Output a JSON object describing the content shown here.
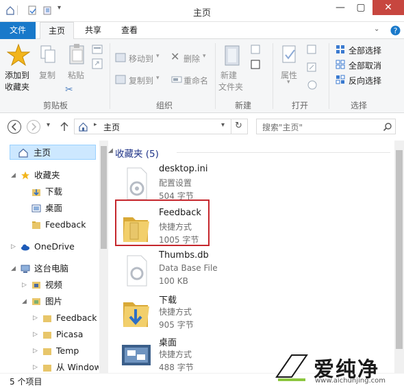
{
  "window": {
    "title": "主页",
    "controls": {
      "minimize": "—",
      "maximize": "▢",
      "close": "✕"
    }
  },
  "tabs": [
    "文件",
    "主页",
    "共享",
    "查看"
  ],
  "ribbon": {
    "pin_label_1": "添加到",
    "pin_label_2": "收藏夹",
    "copy": "复制",
    "paste": "粘贴",
    "clipboard_group": "剪贴板",
    "move_to": "移动到",
    "copy_to": "复制到",
    "delete": "删除",
    "rename": "重命名",
    "organize_group": "组织",
    "new_folder_1": "新建",
    "new_folder_2": "文件夹",
    "new_group": "新建",
    "properties": "属性",
    "open_group": "打开",
    "select_all": "全部选择",
    "select_none": "全部取消",
    "invert_selection": "反向选择",
    "select_group": "选择"
  },
  "address": {
    "path": "主页",
    "search_placeholder": "搜索\"主页\""
  },
  "nav": {
    "home": "主页",
    "favorites": "收藏夹",
    "downloads": "下载",
    "desktop": "桌面",
    "feedback": "Feedback",
    "onedrive": "OneDrive",
    "this_pc": "这台电脑",
    "videos": "视频",
    "pictures": "图片",
    "pic_feedback": "Feedback",
    "picasa": "Picasa",
    "temp": "Temp",
    "from_windows": "从 Window"
  },
  "content": {
    "group_header": "收藏夹 (5)",
    "files": [
      {
        "name": "desktop.ini",
        "type": "配置设置",
        "size": "504 字节",
        "icon": "settings-file-icon"
      },
      {
        "name": "Feedback",
        "type": "快捷方式",
        "size": "1005 字节",
        "icon": "folder-icon"
      },
      {
        "name": "Thumbs.db",
        "type": "Data Base File",
        "size": "100 KB",
        "icon": "database-file-icon"
      },
      {
        "name": "下载",
        "type": "快捷方式",
        "size": "905 字节",
        "icon": "downloads-folder-icon"
      },
      {
        "name": "桌面",
        "type": "快捷方式",
        "size": "488 字节",
        "icon": "desktop-icon"
      }
    ]
  },
  "status": {
    "item_count": "5 个项目"
  },
  "watermark": {
    "text": "爱纯净",
    "url": "www.aichunjing.com"
  },
  "colors": {
    "accent": "#1979ca",
    "close": "#c7463f",
    "highlight": "#c5262c",
    "selection": "#cde8ff"
  }
}
